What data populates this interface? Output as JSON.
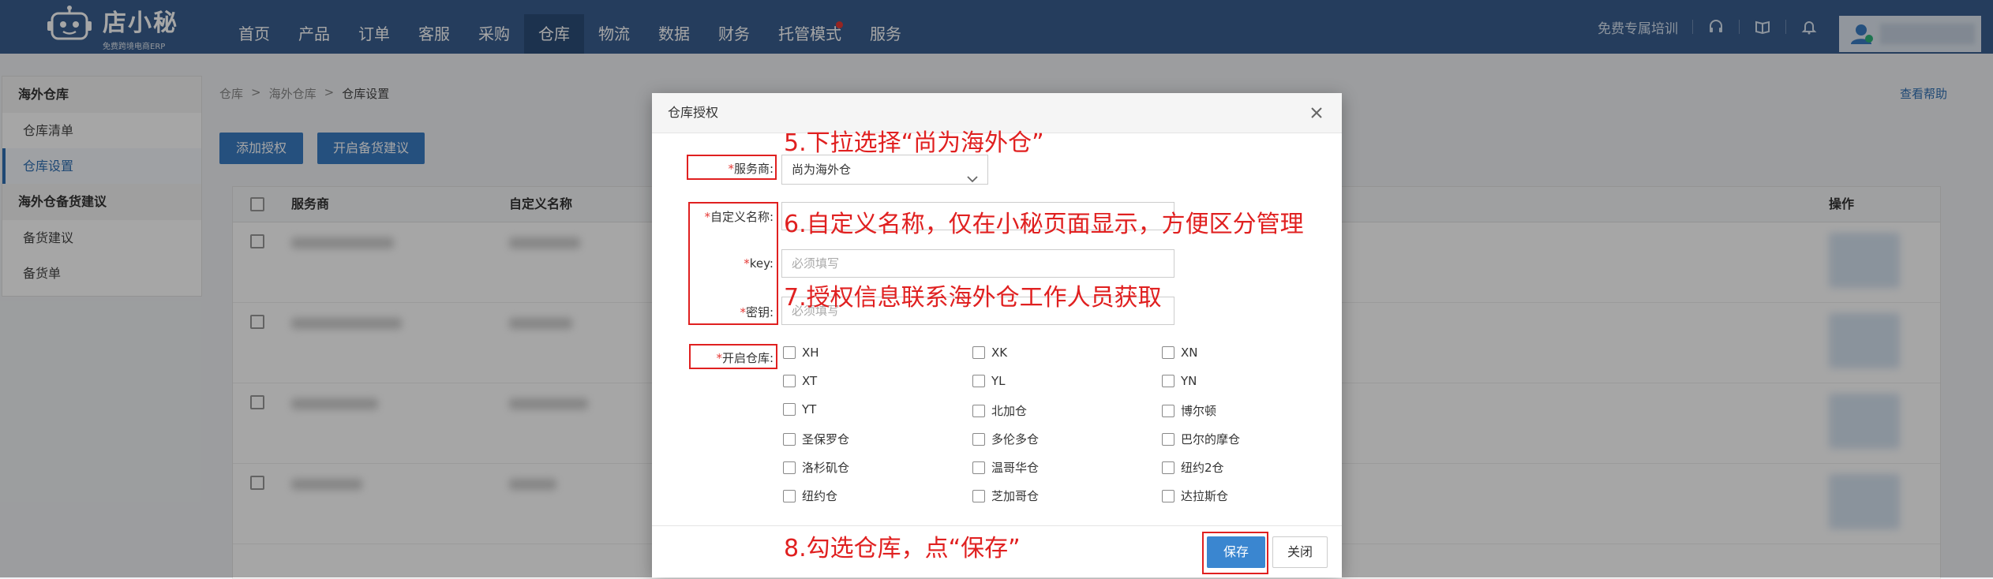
{
  "app": {
    "logo_title": "店小秘",
    "logo_subtitle": "免费跨境电商ERP"
  },
  "nav": {
    "items": [
      {
        "label": "首页"
      },
      {
        "label": "产品"
      },
      {
        "label": "订单"
      },
      {
        "label": "客服"
      },
      {
        "label": "采购"
      },
      {
        "label": "仓库",
        "active": true
      },
      {
        "label": "物流"
      },
      {
        "label": "数据"
      },
      {
        "label": "财务"
      },
      {
        "label": "托管模式",
        "badge": true
      },
      {
        "label": "服务"
      }
    ],
    "training_label": "免费专属培训",
    "icons": [
      "headset-icon",
      "book-icon",
      "bell-icon",
      "user-icon"
    ]
  },
  "sidebar": {
    "groups": [
      {
        "title": "海外仓库",
        "items": [
          {
            "label": "仓库清单"
          },
          {
            "label": "仓库设置",
            "active": true
          }
        ]
      },
      {
        "title": "海外仓备货建议",
        "items": [
          {
            "label": "备货建议"
          },
          {
            "label": "备货单"
          }
        ]
      }
    ]
  },
  "breadcrumb": {
    "items": [
      "仓库",
      "海外仓库",
      "仓库设置"
    ],
    "separator": ">"
  },
  "help_link": "查看帮助",
  "toolbar": {
    "add_label": "添加授权",
    "stock_label": "开启备货建议"
  },
  "table": {
    "columns": [
      "服务商",
      "自定义名称",
      "操作"
    ]
  },
  "modal": {
    "title": "仓库授权",
    "provider_label": "服务商:",
    "provider_value": "尚为海外仓",
    "custom_name_label": "自定义名称:",
    "key_label": "key:",
    "key_placeholder": "必须填写",
    "secret_label": "密钥:",
    "secret_placeholder": "必须填写",
    "warehouses_label": "开启仓库:",
    "warehouses": [
      "XH",
      "XK",
      "XN",
      "XT",
      "YL",
      "YN",
      "YT",
      "北加仓",
      "博尔顿",
      "圣保罗仓",
      "多伦多仓",
      "巴尔的摩仓",
      "洛杉矶仓",
      "温哥华仓",
      "纽约2仓",
      "纽约仓",
      "芝加哥仓",
      "达拉斯仓"
    ],
    "save_label": "保存",
    "close_label": "关闭"
  },
  "annotations": [
    {
      "text": "5.下拉选择“尚为海外仓”"
    },
    {
      "text": "6.自定义名称，仅在小秘页面显示，方便区分管理"
    },
    {
      "text": "7.授权信息联系海外仓工作人员获取"
    },
    {
      "text": "8.勾选仓库，点“保存”"
    }
  ],
  "colors": {
    "topbar": "#3a5f8f",
    "accent": "#3a7bc2",
    "annotation": "#e02020"
  }
}
